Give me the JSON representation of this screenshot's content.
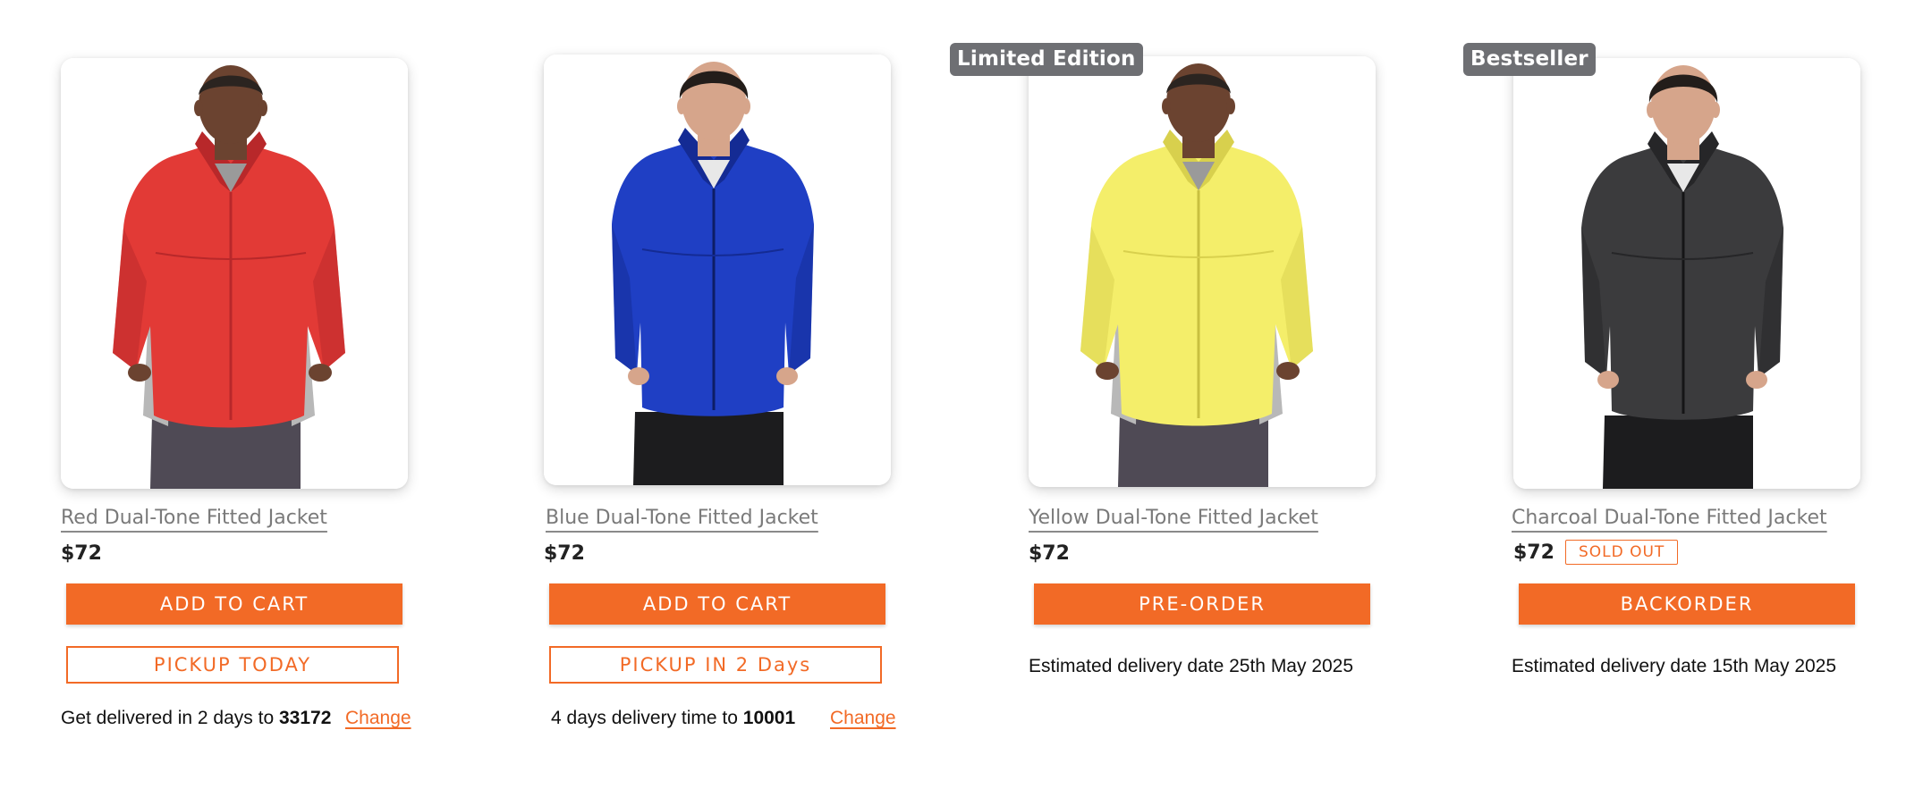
{
  "products": [
    {
      "title": "Red Dual-Tone Fitted Jacket",
      "price": "$72",
      "primary_button": "ADD TO CART",
      "secondary_button": "PICKUP TODAY",
      "delivery_prefix": "Get delivered in 2 days to ",
      "delivery_zip": "33172",
      "change_label": "Change",
      "jacket_color": "#e23a36",
      "jacket_shade": "#b8282a",
      "skin": "#6b4330",
      "hair": "#2b2420",
      "pants": "#4f4a55"
    },
    {
      "title": "Blue Dual-Tone Fitted Jacket",
      "price": "$72",
      "primary_button": "ADD TO CART",
      "secondary_button": "PICKUP IN 2 Days",
      "delivery_prefix": "4 days delivery time to ",
      "delivery_zip": "10001",
      "change_label": "Change",
      "jacket_color": "#1f3fc4",
      "jacket_shade": "#142b94",
      "skin": "#d6a58b",
      "hair": "#231d1a",
      "pants": "#1c1c1e"
    },
    {
      "badge": "Limited Edition",
      "title": "Yellow Dual-Tone Fitted Jacket",
      "price": "$72",
      "primary_button": "PRE-ORDER",
      "estimated": "Estimated delivery date 25th May 2025",
      "jacket_color": "#f4ee6a",
      "jacket_shade": "#d8d04d",
      "skin": "#6b4330",
      "hair": "#2b2420",
      "pants": "#4f4a55"
    },
    {
      "badge": "Bestseller",
      "title": "Charcoal Dual-Tone Fitted Jacket",
      "price": "$72",
      "sold_out": "SOLD OUT",
      "primary_button": "BACKORDER",
      "estimated": "Estimated delivery date 15th May 2025",
      "jacket_color": "#3b3b3d",
      "jacket_shade": "#262628",
      "skin": "#d6a58b",
      "hair": "#231d1a",
      "pants": "#1c1c1e"
    }
  ],
  "colors": {
    "accent": "#f26a26",
    "badge_bg": "#6e6f73"
  }
}
